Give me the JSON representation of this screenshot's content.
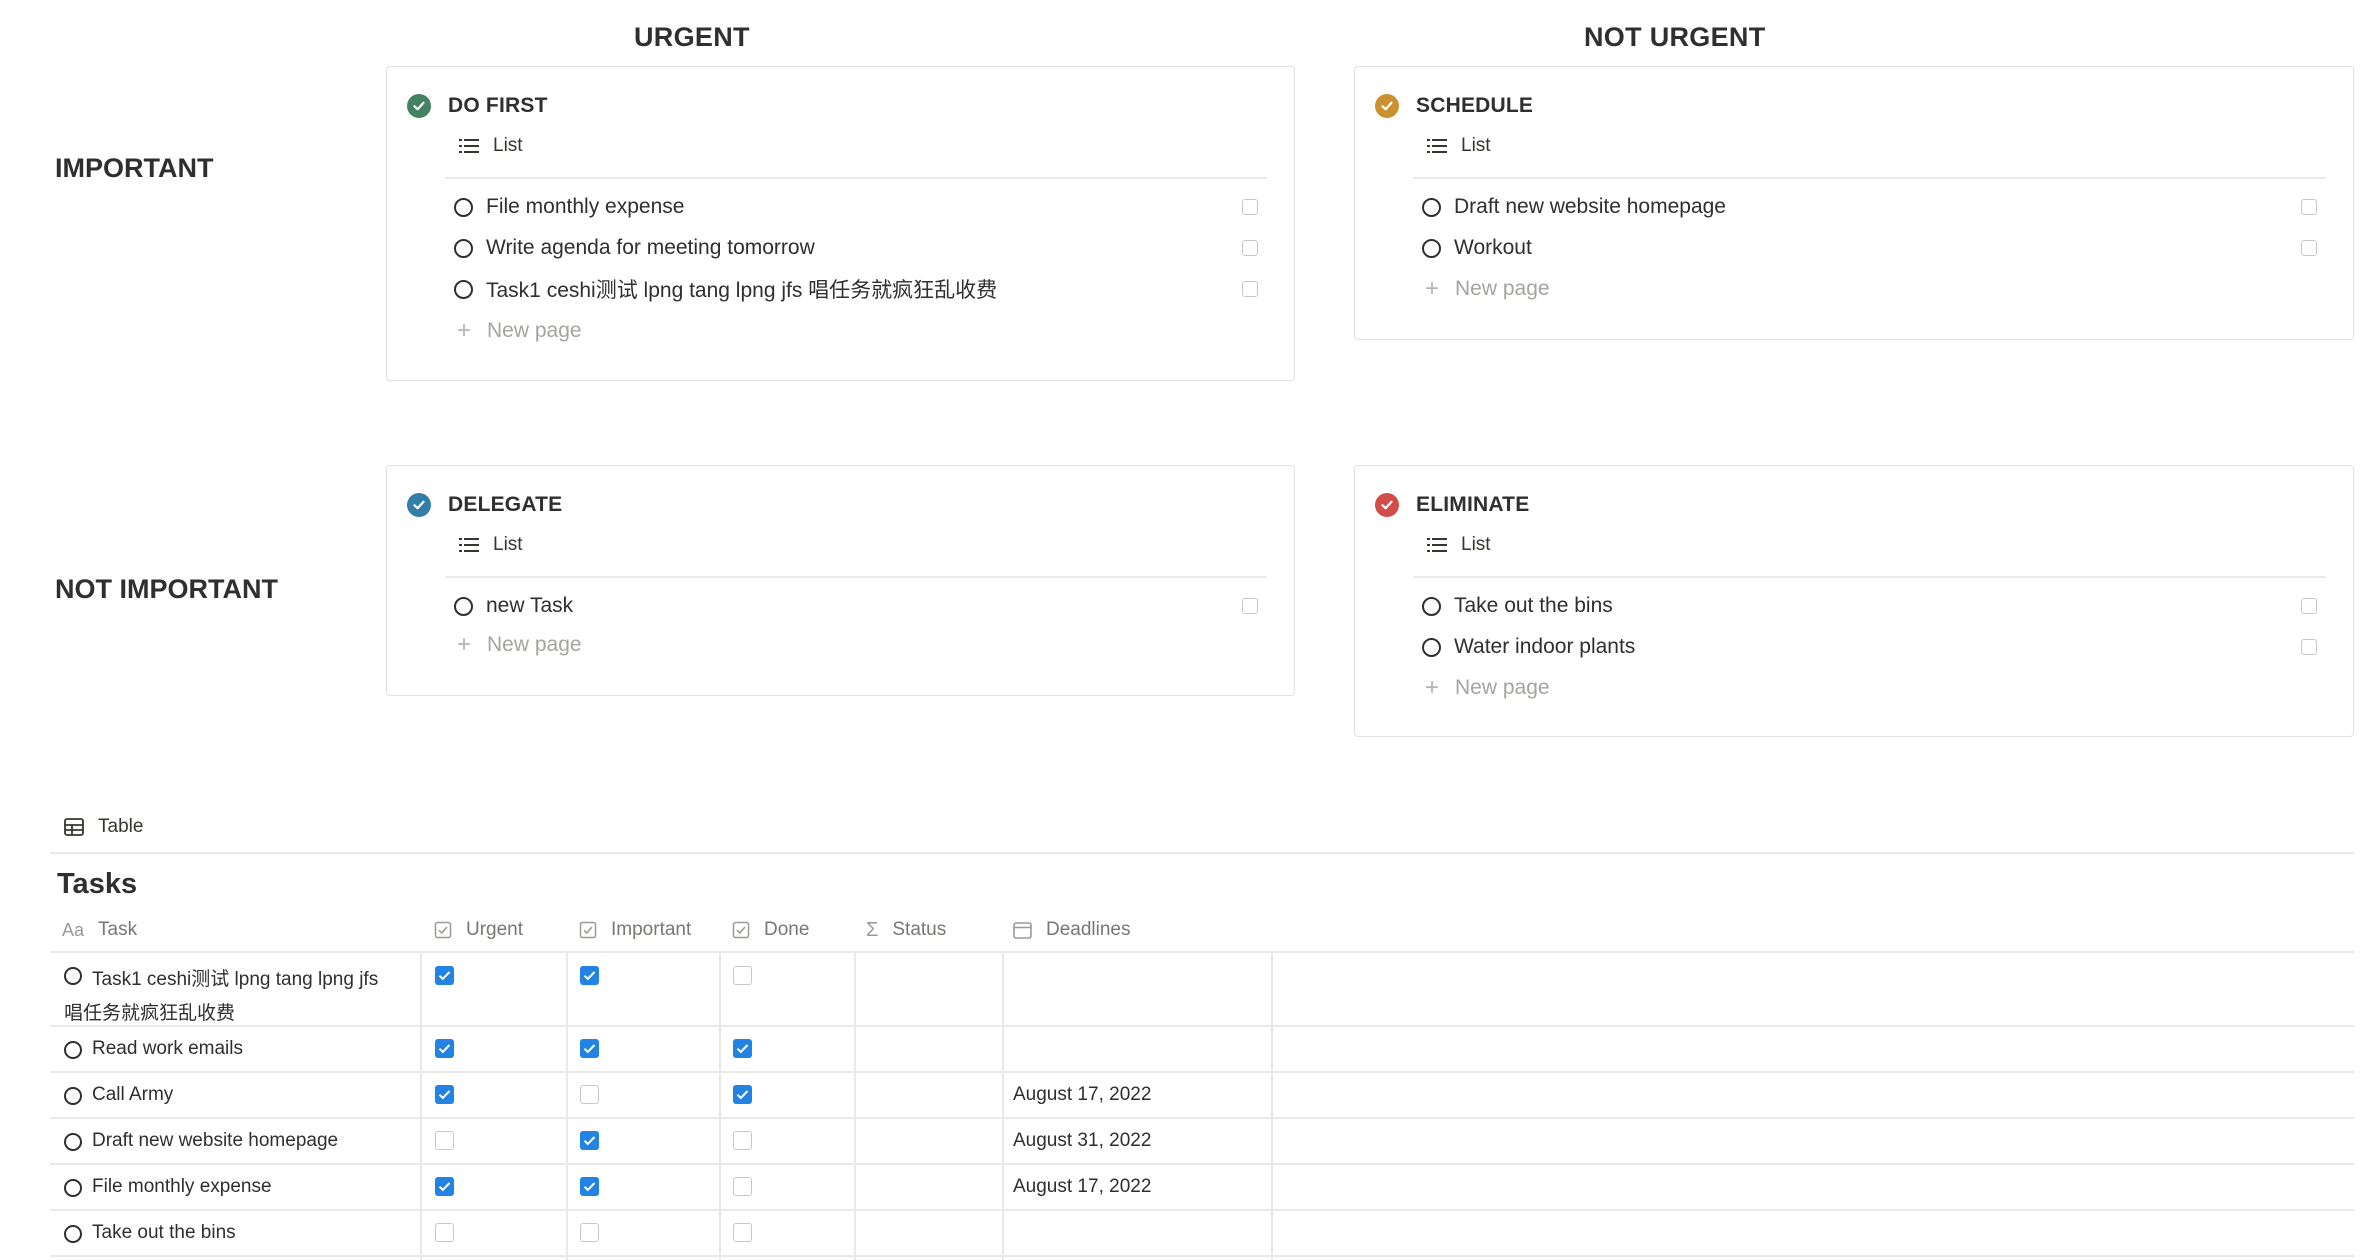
{
  "matrix": {
    "columns": [
      "URGENT",
      "NOT URGENT"
    ],
    "rows": [
      "IMPORTANT",
      "NOT IMPORTANT"
    ],
    "view_label": "List",
    "new_page_label": "New page",
    "cards": {
      "do_first": {
        "title": "DO FIRST",
        "color": "#448361",
        "items": [
          "File monthly expense",
          "Write agenda for meeting tomorrow",
          "Task1 ceshi测试 lpng tang lpng jfs 唱任务就疯狂乱收费"
        ]
      },
      "schedule": {
        "title": "SCHEDULE",
        "color": "#cb912f",
        "items": [
          "Draft new website homepage",
          "Workout"
        ]
      },
      "delegate": {
        "title": "DELEGATE",
        "color": "#337ea9",
        "items": [
          "new Task"
        ]
      },
      "eliminate": {
        "title": "ELIMINATE",
        "color": "#d44c47",
        "items": [
          "Take out the bins",
          "Water indoor plants"
        ]
      }
    }
  },
  "table": {
    "view_label": "Table",
    "title": "Tasks",
    "headers": {
      "task": "Task",
      "urgent": "Urgent",
      "important": "Important",
      "done": "Done",
      "status": "Status",
      "deadlines": "Deadlines"
    },
    "header_icons": {
      "task": "Aa",
      "status": "Σ"
    },
    "rows": [
      {
        "task_line1": "Task1 ceshi测试 lpng tang lpng jfs",
        "task_line2": "唱任务就疯狂乱收费",
        "urgent": true,
        "important": true,
        "done": false,
        "deadline": ""
      },
      {
        "task_line1": "Read work emails",
        "task_line2": "",
        "urgent": true,
        "important": true,
        "done": true,
        "deadline": ""
      },
      {
        "task_line1": "Call Army",
        "task_line2": "",
        "urgent": true,
        "important": false,
        "done": true,
        "deadline": "August 17, 2022"
      },
      {
        "task_line1": "Draft new website homepage",
        "task_line2": "",
        "urgent": false,
        "important": true,
        "done": false,
        "deadline": "August 31, 2022"
      },
      {
        "task_line1": "File monthly expense",
        "task_line2": "",
        "urgent": true,
        "important": true,
        "done": false,
        "deadline": "August 17, 2022"
      },
      {
        "task_line1": "Take out the bins",
        "task_line2": "",
        "urgent": false,
        "important": false,
        "done": false,
        "deadline": ""
      }
    ],
    "accent_color": "#2383e2"
  }
}
